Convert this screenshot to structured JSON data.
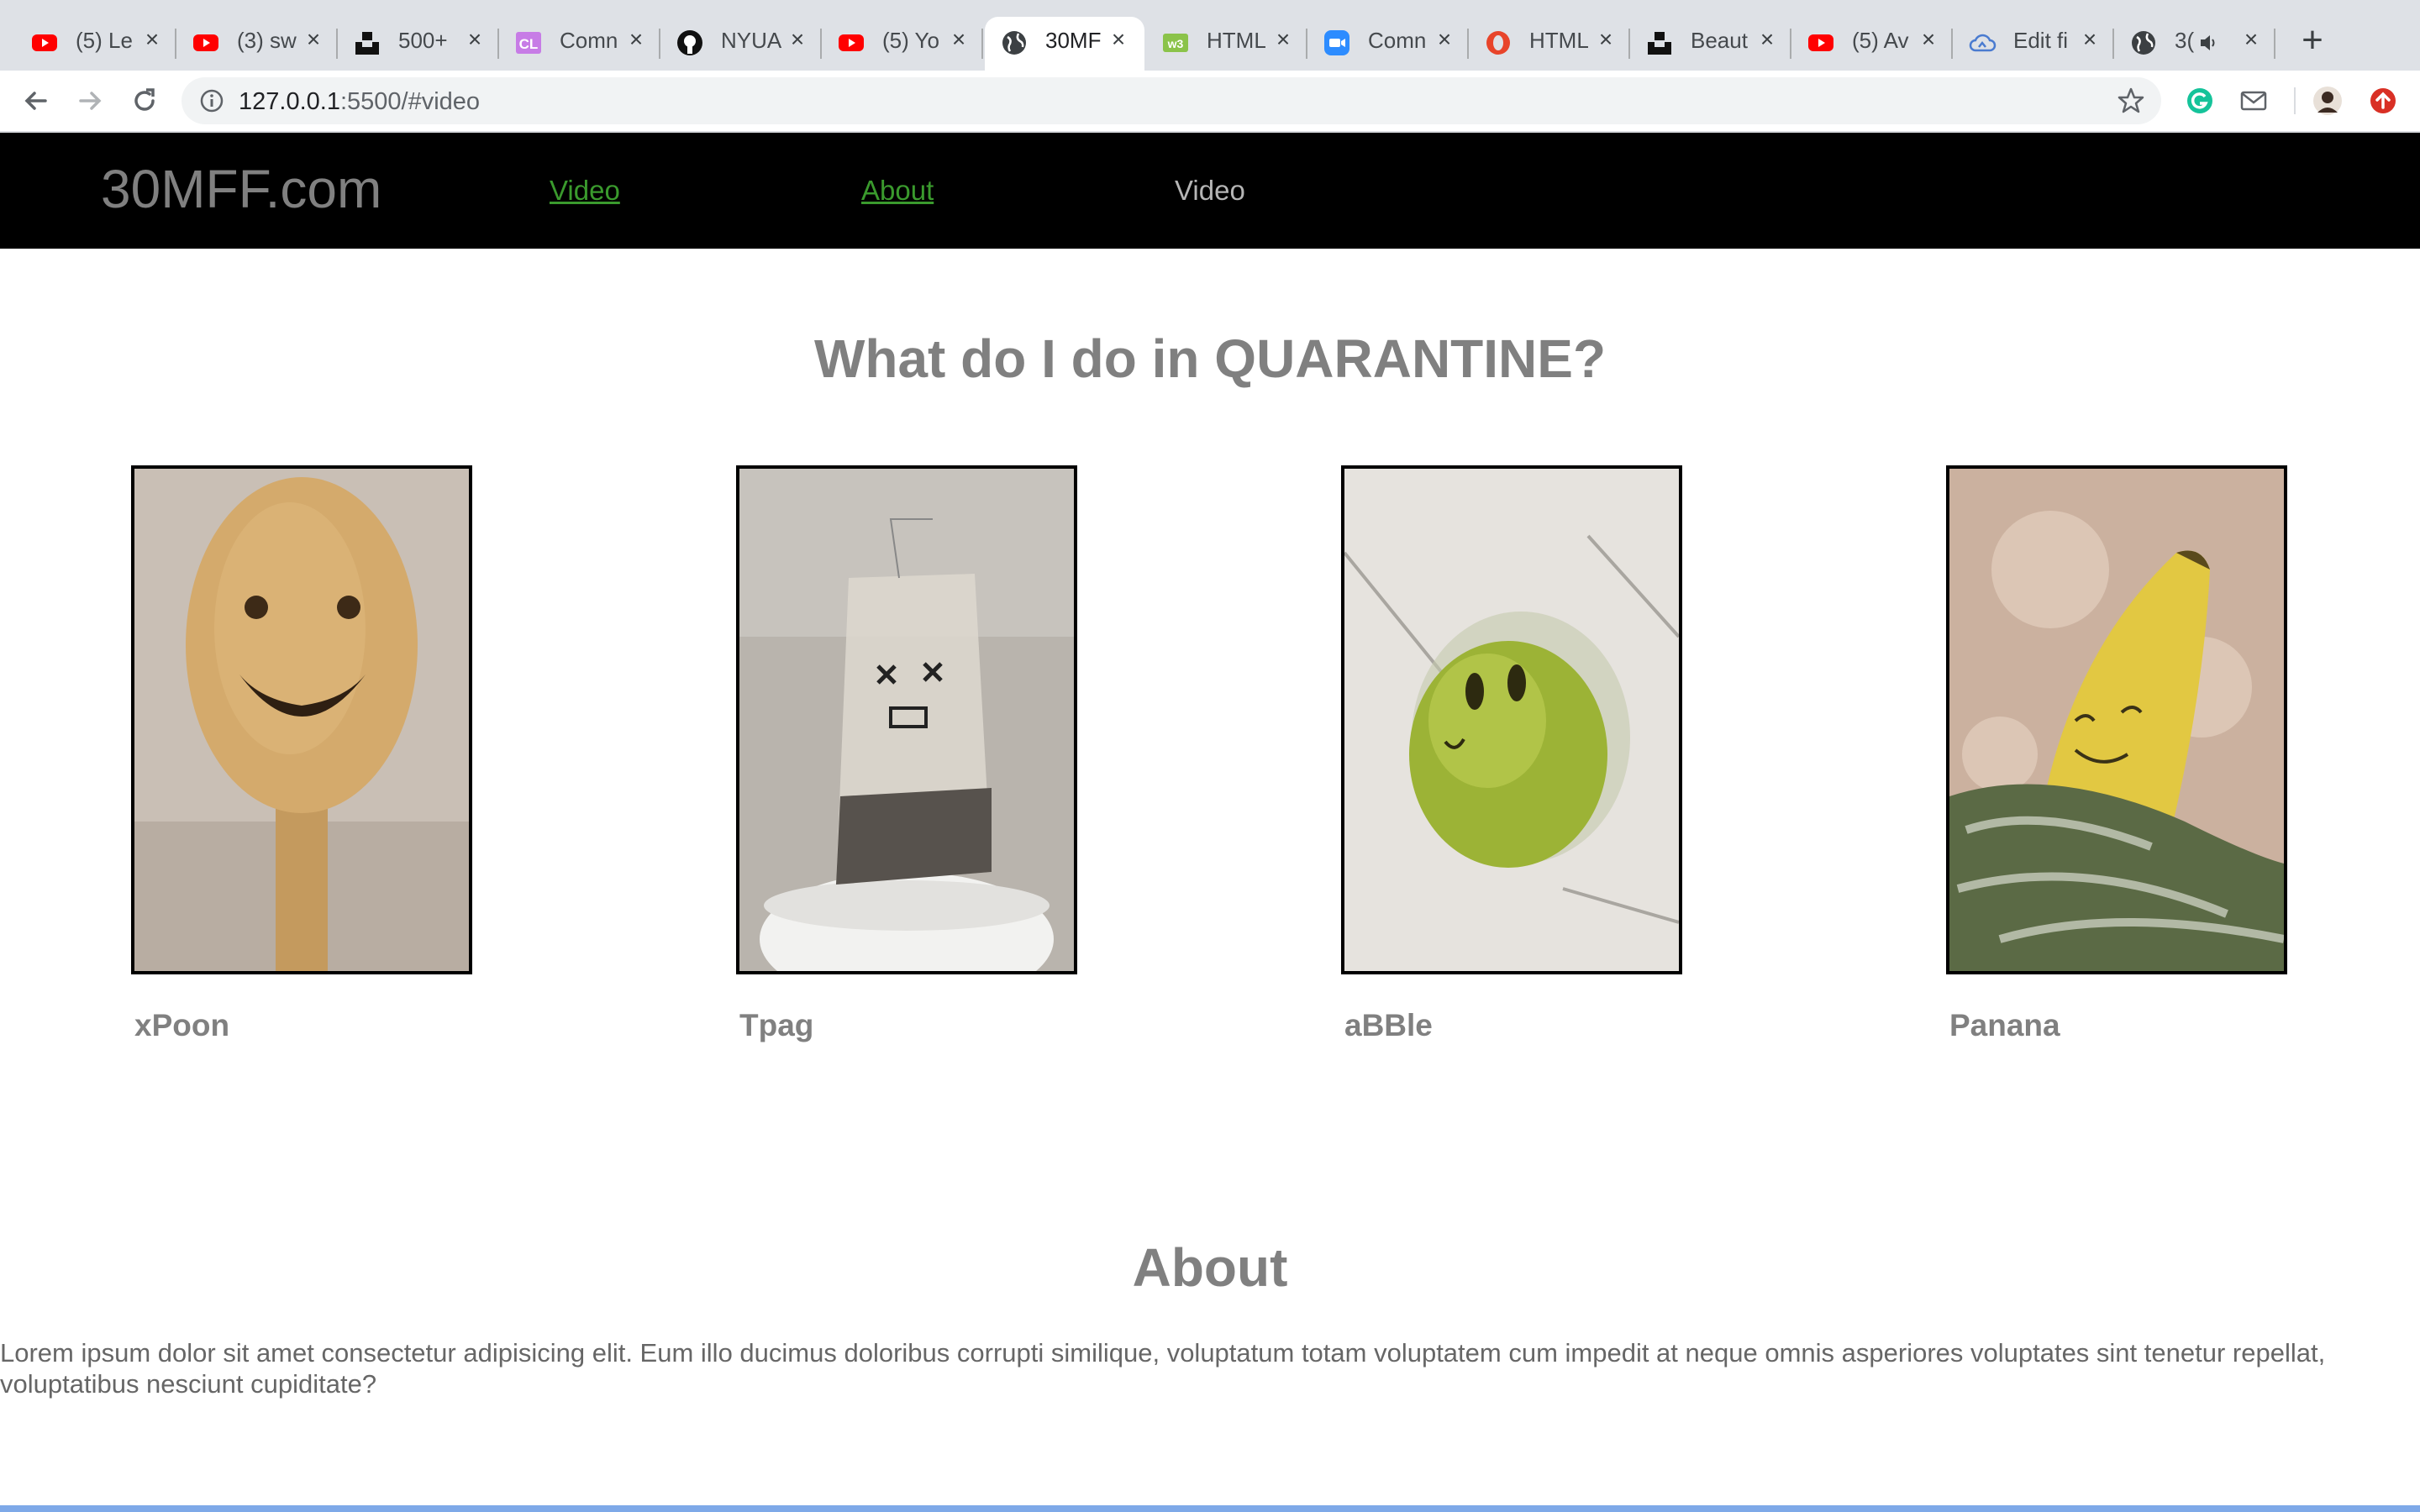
{
  "browser": {
    "tabs": [
      {
        "title": "(5) Le",
        "icon": "youtube-icon"
      },
      {
        "title": "(3) sw",
        "icon": "youtube-icon"
      },
      {
        "title": "500+",
        "icon": "unsplash-icon"
      },
      {
        "title": "Comn",
        "icon": "cl-icon"
      },
      {
        "title": "NYUA",
        "icon": "github-icon"
      },
      {
        "title": "(5) Yo",
        "icon": "youtube-icon"
      },
      {
        "title": "30MF",
        "icon": "globe-icon",
        "active": true
      },
      {
        "title": "HTML",
        "icon": "w3schools-icon"
      },
      {
        "title": "Comn",
        "icon": "zoom-icon"
      },
      {
        "title": "HTML",
        "icon": "opera-icon"
      },
      {
        "title": "Beaut",
        "icon": "unsplash-icon"
      },
      {
        "title": "(5) Av",
        "icon": "youtube-icon"
      },
      {
        "title": "Edit fi",
        "icon": "cloud-icon"
      },
      {
        "title": "3(",
        "icon": "globe-icon",
        "audio": true
      }
    ],
    "url_host": "127.0.0.1",
    "url_rest": ":5500/#video"
  },
  "site": {
    "brand": "30MFF.com",
    "nav": [
      {
        "label": "Video"
      },
      {
        "label": "About"
      },
      {
        "label": "Video"
      }
    ],
    "videos_heading": "What do I do in QUARANTINE?",
    "videos": [
      {
        "label": "xPoon",
        "image": "wooden-spoon-smiley"
      },
      {
        "label": "Tpag",
        "image": "teabag-face"
      },
      {
        "label": "aBBle",
        "image": "green-apple-face"
      },
      {
        "label": "Panana",
        "image": "banana-face"
      }
    ],
    "about_heading": "About",
    "about_text": "Lorem ipsum dolor sit amet consectetur adipisicing elit. Eum illo ducimus doloribus corrupti similique, voluptatum totam voluptatem cum impedit at neque omnis asperiores voluptates sint tenetur repellat, voluptatibus nesciunt cupiditate?"
  },
  "colors": {
    "nav_background": "#000000",
    "link_active": "#3a9a2d",
    "heading_text": "#808080",
    "body_text": "#666666"
  }
}
